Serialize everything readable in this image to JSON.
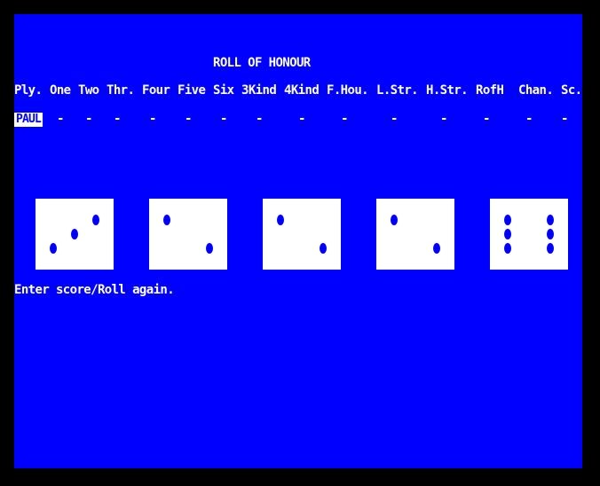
{
  "title": "ROLL OF HONOUR",
  "columns": [
    "Ply.",
    "One",
    "Two",
    "Thr.",
    "Four",
    "Five",
    "Six",
    "3Kind",
    "4Kind",
    "F.Hou.",
    "L.Str.",
    "H.Str.",
    "RofH",
    "Chan.",
    "Sc."
  ],
  "player": {
    "name": "PAUL",
    "scores": [
      "-",
      "-",
      "-",
      "-",
      "-",
      "-",
      "-",
      "-",
      "-",
      "-",
      "-",
      "-",
      "-",
      "-"
    ]
  },
  "dice": [
    3,
    2,
    2,
    2,
    6
  ],
  "prompt": "Enter score/Roll again.",
  "colors": {
    "border": "#000000",
    "screen": "#0000ff",
    "text": "#ffffff",
    "pip": "#0000ff"
  }
}
